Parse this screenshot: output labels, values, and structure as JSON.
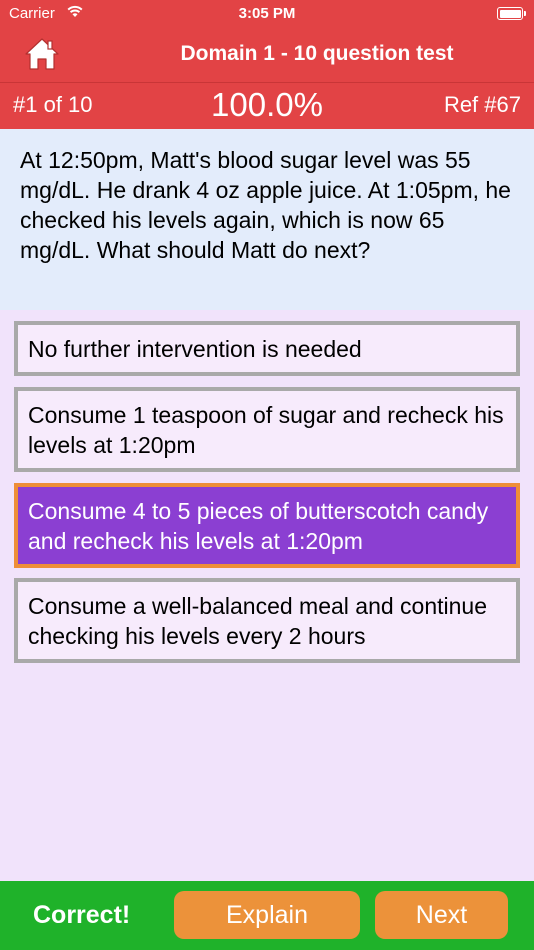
{
  "status_bar": {
    "carrier": "Carrier",
    "time": "3:05 PM"
  },
  "header": {
    "title": "Domain 1 - 10 question test",
    "home_icon": "home-icon"
  },
  "progress": {
    "position": "#1 of 10",
    "score": "100.0%",
    "reference": "Ref #67"
  },
  "question": {
    "text": "At 12:50pm, Matt's blood sugar level was 55 mg/dL.  He drank 4 oz apple juice.  At 1:05pm, he checked his levels again, which is now 65 mg/dL.  What should Matt do next?"
  },
  "answers": [
    {
      "text": "No further intervention is needed"
    },
    {
      "text": "Consume 1 teaspoon of sugar and recheck his levels at 1:20pm"
    },
    {
      "text": "Consume 4 to 5 pieces of butterscotch candy and recheck his levels at 1:20pm"
    },
    {
      "text": "Consume a well-balanced meal and continue checking his levels every 2 hours"
    }
  ],
  "selected_answer_index": 2,
  "footer": {
    "result": "Correct!",
    "explain_label": "Explain",
    "next_label": "Next"
  },
  "colors": {
    "header_red": "#e24345",
    "question_bg": "#e3ecfb",
    "answer_bg": "#f7ebfc",
    "answer_border": "#a9a9a9",
    "selected_bg": "#8b3fd2",
    "selected_border": "#ee8e38",
    "footer_green": "#1fb22a",
    "button_orange": "#ec923a"
  }
}
